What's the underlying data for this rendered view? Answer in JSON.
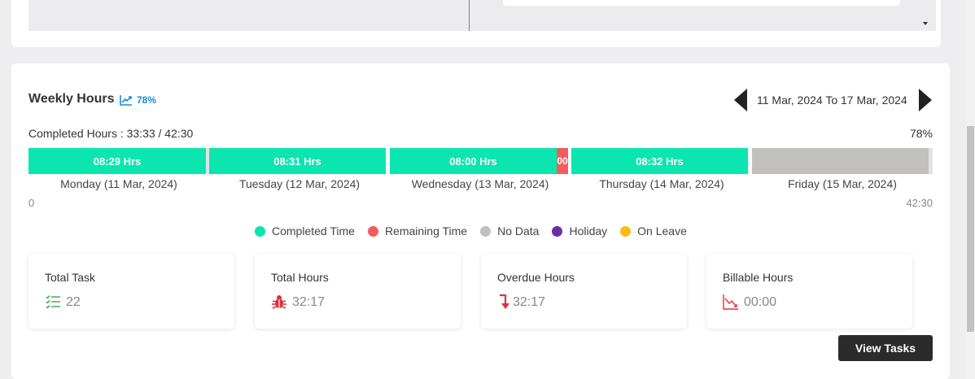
{
  "header": {
    "title": "Weekly Hours",
    "trend_pct": "78%",
    "date_range": "11 Mar, 2024 To 17 Mar, 2024"
  },
  "summary": {
    "completed_hours_label": "Completed Hours : 33:33 / 42:30",
    "percent": "78%"
  },
  "bar": {
    "segments": [
      {
        "day": "Monday (11 Mar, 2024)",
        "completed_label": "08:29 Hrs",
        "completed": "08:29",
        "remaining": "00:01"
      },
      {
        "day": "Tuesday (12 Mar, 2024)",
        "completed_label": "08:31 Hrs",
        "completed": "08:31",
        "remaining": "00:00"
      },
      {
        "day": "Wednesday (13 Mar, 2024)",
        "completed_label": "08:00 Hrs",
        "completed": "08:00",
        "remaining_label": "00",
        "remaining": "00:30"
      },
      {
        "day": "Thursday (14 Mar, 2024)",
        "completed_label": "08:32 Hrs",
        "completed": "08:32",
        "remaining": "00:00"
      },
      {
        "day": "Friday (15 Mar, 2024)",
        "completed_label": "",
        "completed": "00:00",
        "no_data": true
      }
    ],
    "axis_min": "0",
    "axis_max": "42:30"
  },
  "legend": [
    {
      "label": "Completed Time",
      "color": "#0be6b0"
    },
    {
      "label": "Remaining Time",
      "color": "#f25c5c"
    },
    {
      "label": "No Data",
      "color": "#c1c0bf"
    },
    {
      "label": "Holiday",
      "color": "#6a2fa6"
    },
    {
      "label": "On Leave",
      "color": "#fdbb10"
    }
  ],
  "stats": [
    {
      "title": "Total Task",
      "value": "22",
      "icon": "task-list-icon",
      "color": "#3aa655"
    },
    {
      "title": "Total Hours",
      "value": "32:17",
      "icon": "bug-icon",
      "color": "#e0303d"
    },
    {
      "title": "Overdue Hours",
      "value": "32:17",
      "icon": "arrow-down-icon",
      "color": "#e0303d"
    },
    {
      "title": "Billable Hours",
      "value": "00:00",
      "icon": "chart-down-icon",
      "color": "#e0303d"
    }
  ],
  "actions": {
    "view_tasks": "View Tasks"
  },
  "colors": {
    "completed": "#0be6b0",
    "remaining": "#f25c5c",
    "no_data": "#c1c0bf",
    "accent": "#1b8ad8"
  }
}
